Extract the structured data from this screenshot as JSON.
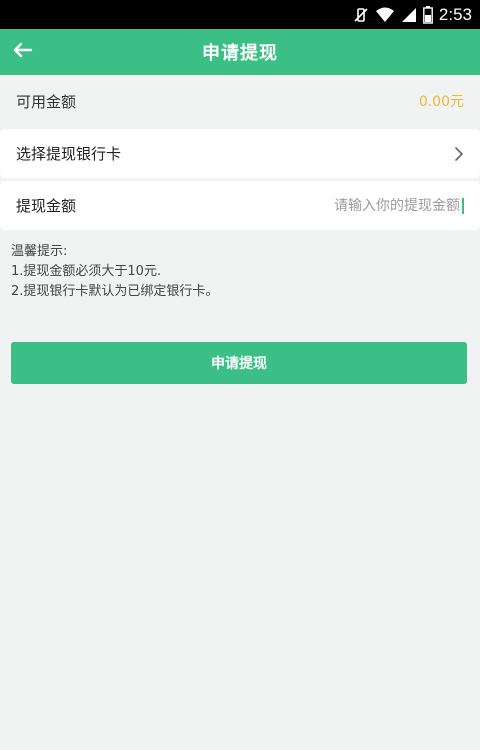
{
  "status_bar": {
    "time": "2:53",
    "icons": [
      "vibrate-off-icon",
      "wifi-icon",
      "signal-icon",
      "battery-icon"
    ]
  },
  "header": {
    "title": "申请提现",
    "back_icon": "arrow-left-icon"
  },
  "balance": {
    "label": "可用金额",
    "value": "0.00元"
  },
  "bank_card": {
    "label": "选择提现银行卡",
    "icon": "chevron-right-icon"
  },
  "amount": {
    "label": "提现金额",
    "value": "",
    "placeholder": "请输入你的提现金额"
  },
  "tips": {
    "title": "温馨提示:",
    "line1": "1.提现金额必须大于10元.",
    "line2": "2.提现银行卡默认为已绑定银行卡。"
  },
  "submit": {
    "label": "申请提现"
  },
  "colors": {
    "accent": "#3bbf87",
    "balance_value": "#f0b63c",
    "background": "#f1f3f2"
  }
}
